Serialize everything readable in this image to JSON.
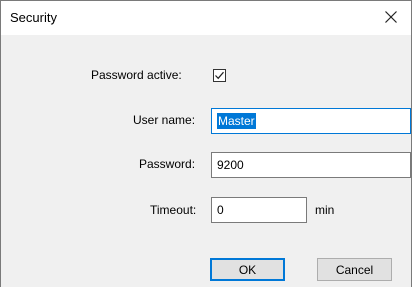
{
  "window": {
    "title": "Security"
  },
  "form": {
    "password_active_label": "Password  active:",
    "password_active_checked": true,
    "user_name_label": "User name:",
    "user_name_value": "Master",
    "password_label": "Password:",
    "password_value": "9200",
    "timeout_label": "Timeout:",
    "timeout_value": "0",
    "timeout_unit": "min"
  },
  "buttons": {
    "ok_label": "OK",
    "cancel_label": "Cancel"
  },
  "icons": {
    "close": "close-icon",
    "check": "check-icon"
  },
  "colors": {
    "accent": "#0078d7",
    "content_bg": "#f0f0f0"
  }
}
